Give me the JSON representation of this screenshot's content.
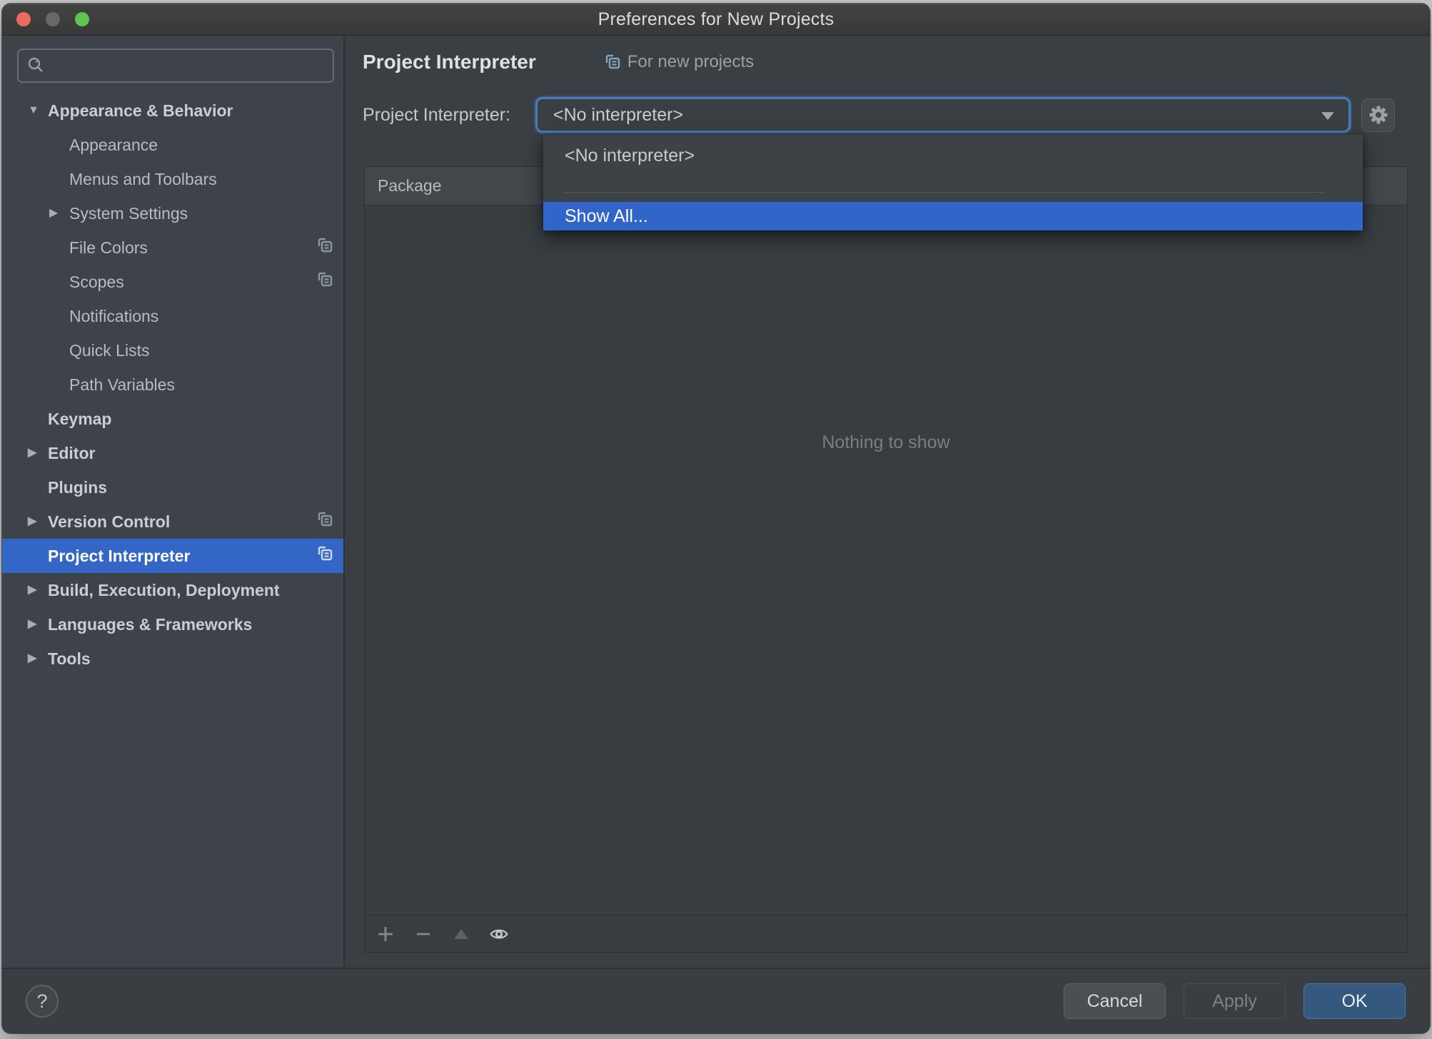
{
  "window": {
    "title": "Preferences for New Projects"
  },
  "sidebar": {
    "search": {
      "value": ""
    },
    "items": [
      {
        "label": "Appearance & Behavior"
      },
      {
        "label": "Appearance"
      },
      {
        "label": "Menus and Toolbars"
      },
      {
        "label": "System Settings"
      },
      {
        "label": "File Colors"
      },
      {
        "label": "Scopes"
      },
      {
        "label": "Notifications"
      },
      {
        "label": "Quick Lists"
      },
      {
        "label": "Path Variables"
      },
      {
        "label": "Keymap"
      },
      {
        "label": "Editor"
      },
      {
        "label": "Plugins"
      },
      {
        "label": "Version Control"
      },
      {
        "label": "Project Interpreter"
      },
      {
        "label": "Build, Execution, Deployment"
      },
      {
        "label": "Languages & Frameworks"
      },
      {
        "label": "Tools"
      }
    ]
  },
  "content": {
    "page_title": "Project Interpreter",
    "scope_label": "For new projects",
    "interpreter": {
      "label": "Project Interpreter:",
      "value": "<No interpreter>"
    },
    "dropdown": {
      "option_no_interpreter": "<No interpreter>",
      "option_show_all": "Show All..."
    },
    "table": {
      "column_package": "Package",
      "empty_text": "Nothing to show"
    }
  },
  "footer": {
    "help_label": "?",
    "cancel_label": "Cancel",
    "apply_label": "Apply",
    "ok_label": "OK"
  },
  "colors": {
    "selection_blue": "#3366c6",
    "popup_highlight": "#3165c9",
    "focus_ring": "#4a7cb8",
    "ok_button": "#35597e"
  }
}
